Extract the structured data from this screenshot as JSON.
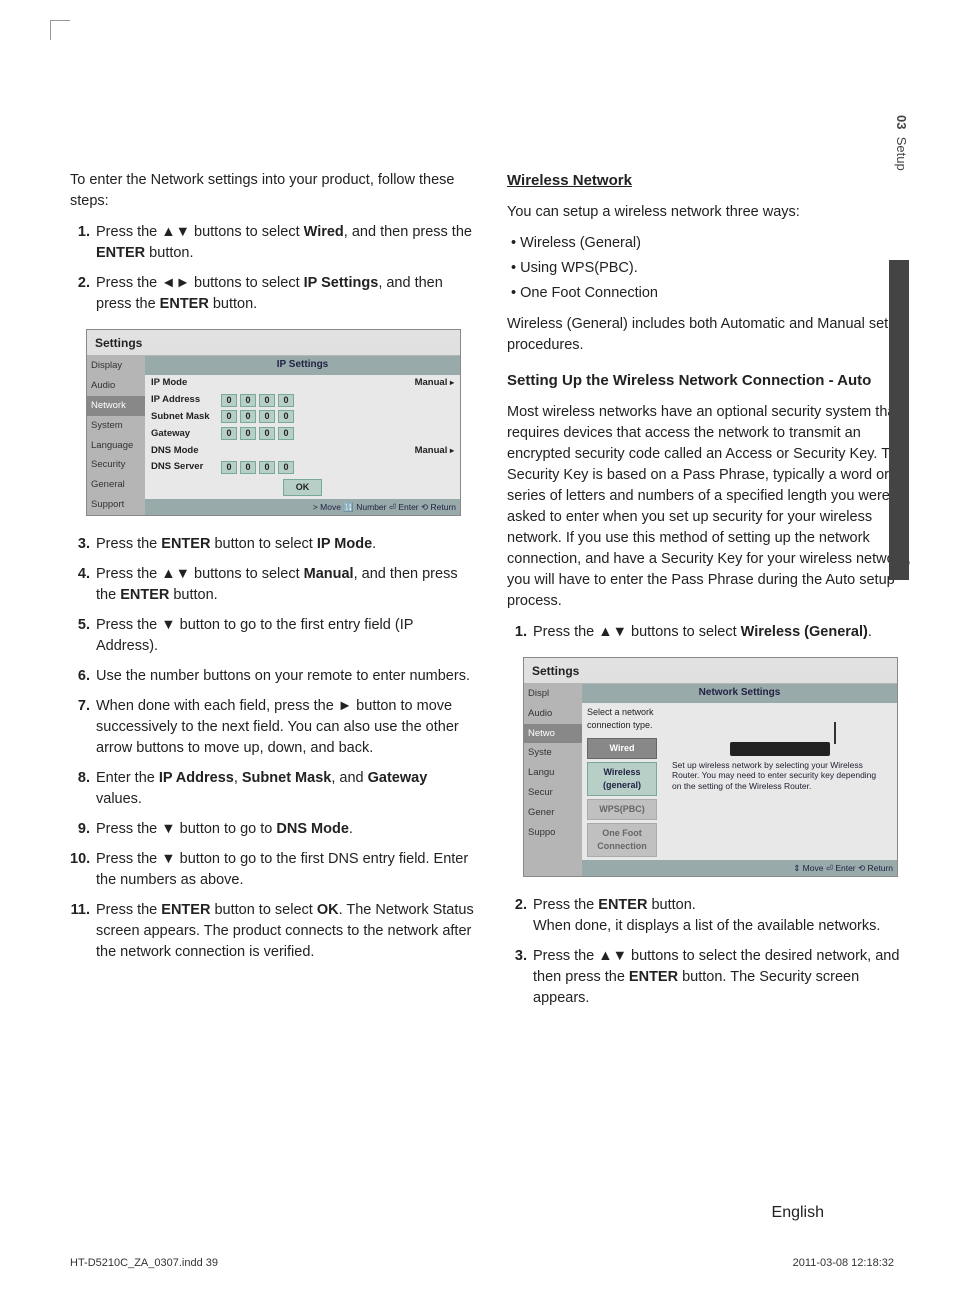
{
  "sidetab": {
    "num": "03",
    "label": "Setup"
  },
  "left": {
    "intro": "To enter the Network settings into your product, follow these steps:",
    "steps_a": [
      {
        "n": "1.",
        "pre": "Press the ",
        "arrows": "▲▼",
        "mid": " buttons to select ",
        "bold": "Wired",
        "post": ", and then press the ",
        "bold2": "ENTER",
        "post2": " button."
      },
      {
        "n": "2.",
        "pre": "Press the ",
        "arrows": "◄►",
        "mid": " buttons to select ",
        "bold": "IP Settings",
        "post": ", and then press the ",
        "bold2": "ENTER",
        "post2": " button."
      }
    ],
    "steps_b": [
      {
        "n": "3.",
        "html": "Press the <b>ENTER</b> button to select <b>IP Mode</b>."
      },
      {
        "n": "4.",
        "html": "Press the ▲▼ buttons to select <b>Manual</b>, and then press the <b>ENTER</b> button."
      },
      {
        "n": "5.",
        "html": "Press the ▼ button to go to the first entry field (IP Address)."
      },
      {
        "n": "6.",
        "html": "Use the number buttons on your remote to enter numbers."
      },
      {
        "n": "7.",
        "html": "When done with each field, press the ► button to move successively to the next field. You can also use the other arrow buttons to move up, down, and back."
      },
      {
        "n": "8.",
        "html": "Enter the <b>IP Address</b>, <b>Subnet Mask</b>, and <b>Gateway</b> values."
      },
      {
        "n": "9.",
        "html": "Press the ▼ button to go to <b>DNS Mode</b>."
      },
      {
        "n": "10.",
        "html": "Press the ▼ button to go to the first DNS entry field. Enter the numbers as above."
      },
      {
        "n": "11.",
        "html": "Press the <b>ENTER</b> button to select <b>OK</b>. The Network Status screen appears. The product connects to the network after the network connection is verified."
      }
    ]
  },
  "right": {
    "heading": "Wireless Network",
    "intro": "You can setup a wireless network three ways:",
    "bullets": [
      "Wireless (General)",
      "Using WPS(PBC).",
      "One Foot Connection"
    ],
    "after_bullets": "Wireless (General) includes both Automatic and Manual setup procedures.",
    "sub": "Setting Up the Wireless Network Connection - Auto",
    "para": "Most wireless networks have an optional security system that requires devices that access the network to transmit an encrypted security code called an Access or Security Key. The Security Key is based on a Pass Phrase, typically a word or a series of letters and numbers of a specified length you were asked to enter when you set up security for your wireless network. If you use this method of setting up the network connection, and have a Security Key for your wireless network, you will have to enter the Pass Phrase during the Auto setup process.",
    "steps_c": [
      {
        "n": "1.",
        "html": "Press the ▲▼ buttons to select <b>Wireless (General)</b>."
      }
    ],
    "steps_d": [
      {
        "n": "2.",
        "html": "Press the <b>ENTER</b> button.<br>When done, it displays a list of the available networks."
      },
      {
        "n": "3.",
        "html": "Press the ▲▼ buttons to select the desired network, and then press the <b>ENTER</b> button. The Security screen appears."
      }
    ]
  },
  "ss1": {
    "head": "Settings",
    "side": [
      "Display",
      "Audio",
      "Network",
      "System",
      "Language",
      "Security",
      "General",
      "Support"
    ],
    "title": "IP Settings",
    "rows": [
      {
        "label": "IP Mode",
        "type": "text",
        "val": "Manual"
      },
      {
        "label": "IP Address",
        "type": "ip"
      },
      {
        "label": "Subnet Mask",
        "type": "ip"
      },
      {
        "label": "Gateway",
        "type": "ip"
      },
      {
        "label": "DNS Mode",
        "type": "text",
        "val": "Manual"
      },
      {
        "label": "DNS Server",
        "type": "ip"
      }
    ],
    "ok": "OK",
    "foot": "> Move     🔢 Number   ⏎ Enter   ⟲ Return"
  },
  "ss2": {
    "head": "Settings",
    "side": [
      "Display",
      "Audio",
      "Network",
      "System",
      "Language",
      "Security",
      "General",
      "Support"
    ],
    "title": "Network Settings",
    "prompt": "Select a network connection type.",
    "btns": [
      {
        "label": "Wired",
        "cls": "sel"
      },
      {
        "label": "Wireless (general)",
        "cls": ""
      },
      {
        "label": "WPS(PBC)",
        "cls": "dim"
      },
      {
        "label": "One Foot Connection",
        "cls": "dim"
      }
    ],
    "note": "Set up wireless network by selecting your Wireless Router. You may need to enter security key depending on the setting of the Wireless Router.",
    "foot": "⇕ Move   ⏎ Enter   ⟲ Return"
  },
  "english": "English",
  "footer": {
    "left": "HT-D5210C_ZA_0307.indd   39",
    "right": "2011-03-08   12:18:32"
  }
}
